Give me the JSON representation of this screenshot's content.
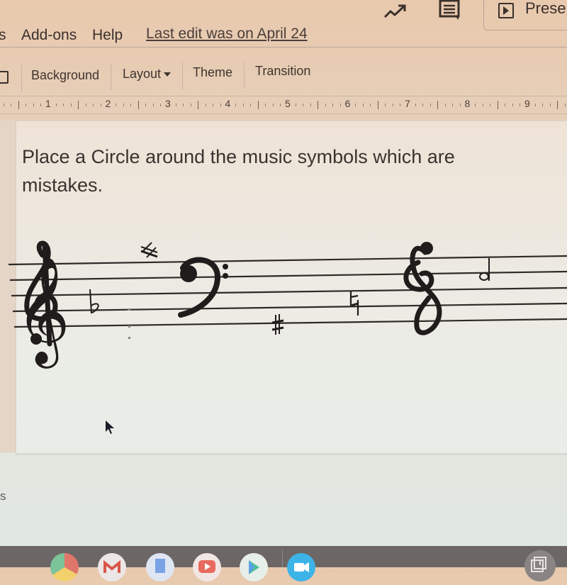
{
  "menubar": {
    "partial_item": "s",
    "items": [
      "Add-ons",
      "Help"
    ],
    "last_edit": "Last edit was on April 24"
  },
  "header_right": {
    "icons": [
      "trending-icon",
      "comments-icon"
    ],
    "present_label": "Prese"
  },
  "toolbar": {
    "background_label": "Background",
    "layout_label": "Layout",
    "theme_label": "Theme",
    "transition_label": "Transition"
  },
  "ruler": {
    "numbers": [
      "1",
      "2",
      "3",
      "4",
      "5",
      "6",
      "7",
      "8",
      "9"
    ]
  },
  "slide": {
    "instruction": "Place a Circle around the music symbols which are mistakes.",
    "staff_symbols": [
      "treble-clef",
      "flat",
      "faint-dots",
      "sharp-above-staff",
      "bass-clef",
      "sharp-below-staff",
      "natural",
      "backwards-treble-clef",
      "backwards-half-note"
    ]
  },
  "side_label": "s",
  "shelf": {
    "apps": [
      "chrome",
      "gmail",
      "docs",
      "youtube",
      "play-store",
      "meet"
    ],
    "colors": {
      "chrome": "#e5a39a",
      "gmail": "#ece7e6",
      "docs": "#dfe6f3",
      "youtube": "#e86a5e",
      "play-store": "#e7efe9",
      "meet": "#3cb4e8"
    }
  }
}
